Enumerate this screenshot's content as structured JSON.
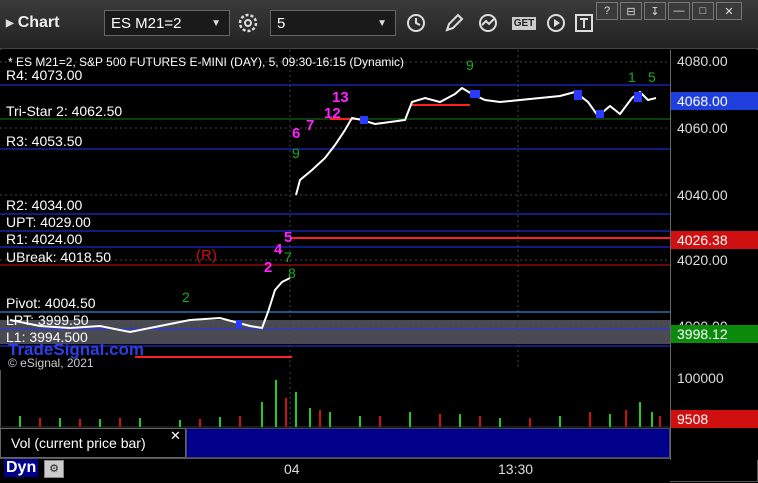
{
  "toolbar": {
    "app_title": "Chart",
    "symbol_value": "ES M21=2",
    "interval_value": "5",
    "get_label": "GET"
  },
  "chart": {
    "header": "* ES M21=2, S&P 500 FUTURES E-MINI (DAY), 5, 09:30-16:15 (Dynamic)",
    "watermark": "TradeSignal.com",
    "copyright": "© eSignal, 2021",
    "yaxis_ticks": [
      "4080.00",
      "4060.00",
      "4040.00",
      "4020.00",
      "4000.00"
    ],
    "price_tags": [
      {
        "text": "4068.00",
        "bg": "#1f3fdf"
      },
      {
        "text": "4026.38",
        "bg": "#d01010"
      },
      {
        "text": "3998.12",
        "bg": "#0b8a0b"
      }
    ],
    "levels": [
      {
        "label": "R4: 4073.00",
        "color": "#2233ff"
      },
      {
        "label": "Tri-Star 2: 4062.50",
        "color": "#1a7a1a"
      },
      {
        "label": "R3: 4053.50",
        "color": "#2233ff"
      },
      {
        "label": "R2: 4034.00",
        "color": "#2233ff"
      },
      {
        "label": "UPT: 4029.00",
        "color": "#2233ff"
      },
      {
        "label": "R1: 4024.00",
        "color": "#2233ff"
      },
      {
        "label": "UBreak: 4018.50",
        "color": "#cc1111"
      },
      {
        "label": "Pivot: 4004.50",
        "color": "#33aaff"
      },
      {
        "label": "LPT: 3999.50",
        "color": "#2233ff"
      },
      {
        "label": "L1: 3994.500",
        "color": "#2233ff"
      }
    ],
    "annotations": {
      "r_marker": "(R)",
      "magenta_counts": [
        "6",
        "7",
        "12",
        "13",
        "2",
        "4",
        "5"
      ],
      "green_counts": [
        "9",
        "2",
        "7",
        "8",
        "1",
        "5",
        "6",
        "9"
      ]
    }
  },
  "volume": {
    "label": "Vol (current price bar)",
    "ytick": "100000",
    "tag": "9508",
    "tag_bg": "#d01010"
  },
  "xaxis": {
    "ticks": [
      "04",
      "13:30"
    ]
  },
  "footer": {
    "dyn": "Dyn"
  }
}
